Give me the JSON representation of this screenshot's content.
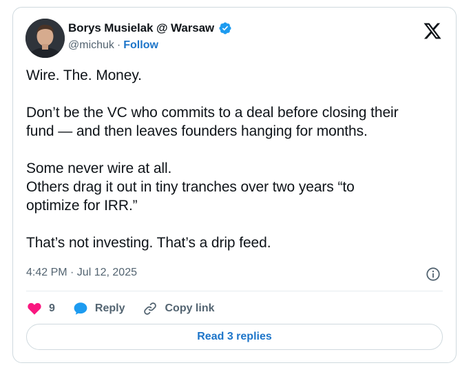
{
  "author": {
    "display_name": "Borys Musielak @ Warsaw",
    "handle": "@michuk",
    "separator": "·",
    "follow_label": "Follow"
  },
  "tweet": {
    "paragraphs": [
      [
        "Wire. The. Money."
      ],
      [
        "Don’t be the VC who commits to a deal before closing their",
        "fund — and then leaves founders hanging for months."
      ],
      [
        "Some never wire at all.",
        "Others drag it out in tiny tranches over two years “to",
        "optimize for IRR.”"
      ],
      [
        "That’s not investing. That’s a drip feed."
      ]
    ],
    "timestamp": "4:42 PM · Jul 12, 2025"
  },
  "actions": {
    "like_count": "9",
    "reply_label": "Reply",
    "copy_link_label": "Copy link"
  },
  "read_replies_label": "Read 3 replies",
  "colors": {
    "link_blue": "#1d75c9",
    "verified_blue": "#1d9bf0",
    "heart_pink": "#f91880",
    "muted_text": "#536471"
  },
  "icons": [
    "verified-badge-icon",
    "x-logo-icon",
    "info-icon",
    "heart-icon",
    "reply-bubble-icon",
    "link-icon"
  ]
}
